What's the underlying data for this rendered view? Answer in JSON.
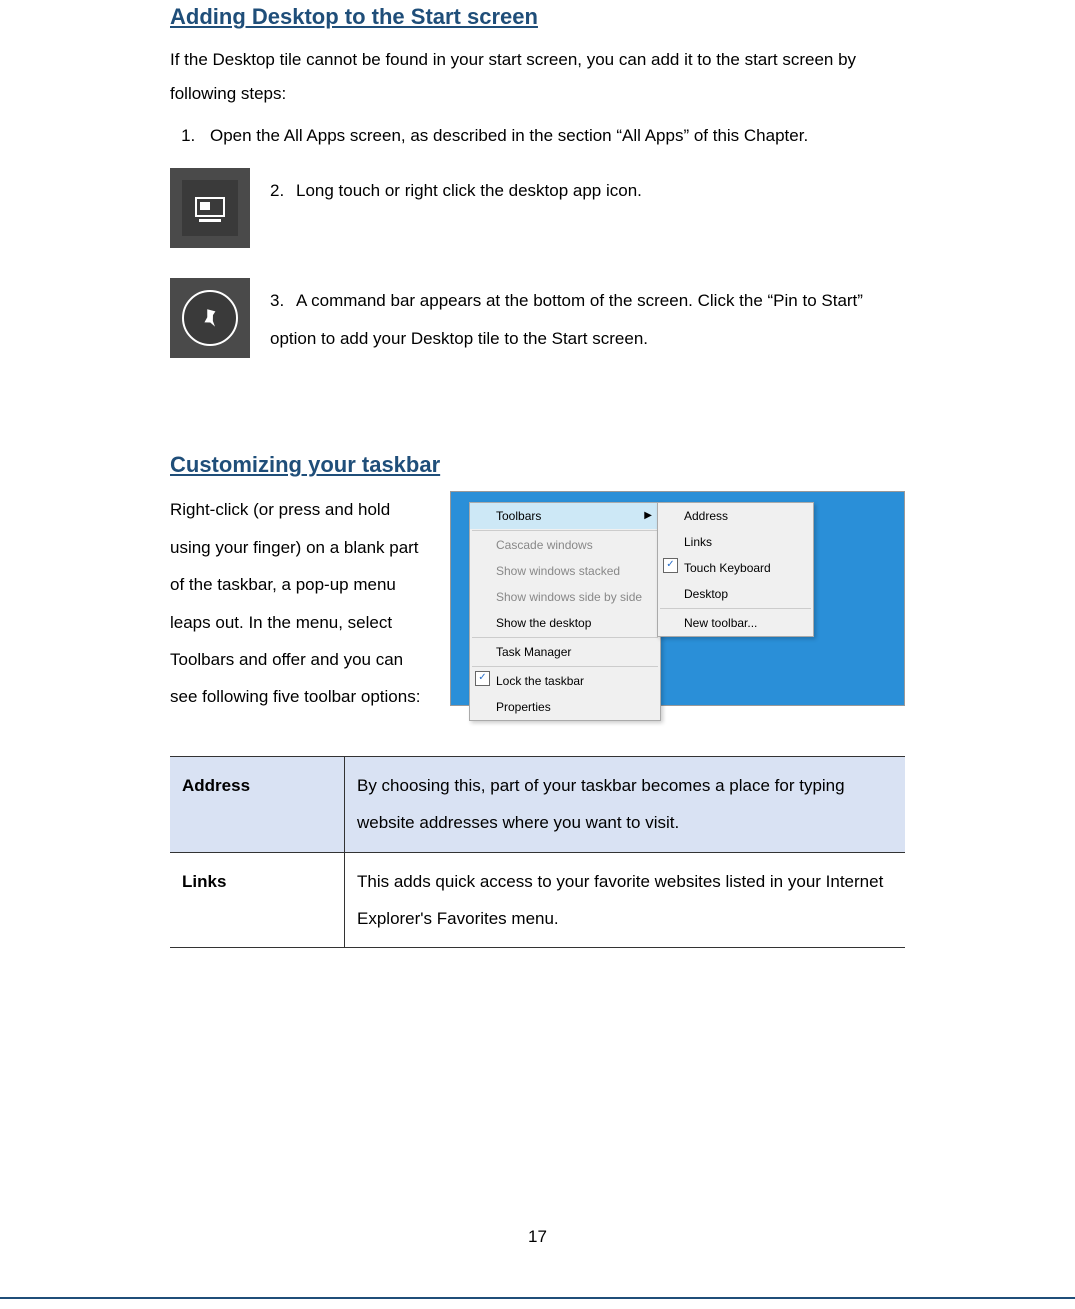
{
  "section1": {
    "heading": "Adding Desktop to the Start screen",
    "intro": "If the Desktop tile cannot be found in your start screen, you can add it to the start screen by following steps:",
    "step1": "Open the All Apps screen, as described in the section “All Apps” of this Chapter.",
    "step2_num": "2.",
    "step2": "Long touch or right click the desktop app icon.",
    "step3_num": "3.",
    "step3": "A command bar appears at the bottom of the screen. Click the “Pin to Start” option to add your Desktop tile to the Start screen."
  },
  "section2": {
    "heading": "Customizing your taskbar",
    "para": "Right-click (or press and hold using your finger) on a blank part of the taskbar, a pop-up menu leaps out. In the menu, select Toolbars and offer and you can see following five toolbar options:"
  },
  "context_menu": {
    "items": [
      {
        "label": "Toolbars",
        "highlighted": true,
        "arrow": true
      },
      {
        "sep": true
      },
      {
        "label": "Cascade windows",
        "disabled": true
      },
      {
        "label": "Show windows stacked",
        "disabled": true
      },
      {
        "label": "Show windows side by side",
        "disabled": true
      },
      {
        "label": "Show the desktop"
      },
      {
        "sep": true
      },
      {
        "label": "Task Manager"
      },
      {
        "sep": true
      },
      {
        "label": "Lock the taskbar",
        "checked": true
      },
      {
        "label": "Properties"
      }
    ],
    "submenu": [
      {
        "label": "Address"
      },
      {
        "label": "Links"
      },
      {
        "label": "Touch Keyboard",
        "checked": true
      },
      {
        "label": "Desktop"
      },
      {
        "sep": true
      },
      {
        "label": "New toolbar..."
      }
    ]
  },
  "table": {
    "rows": [
      {
        "term": "Address",
        "def": "By choosing this, part of your taskbar becomes a place for typing website addresses where you want to visit."
      },
      {
        "term": "Links",
        "def": "This adds quick access to your favorite websites listed in your Internet Explorer's Favorites menu."
      }
    ]
  },
  "page_number": "17"
}
